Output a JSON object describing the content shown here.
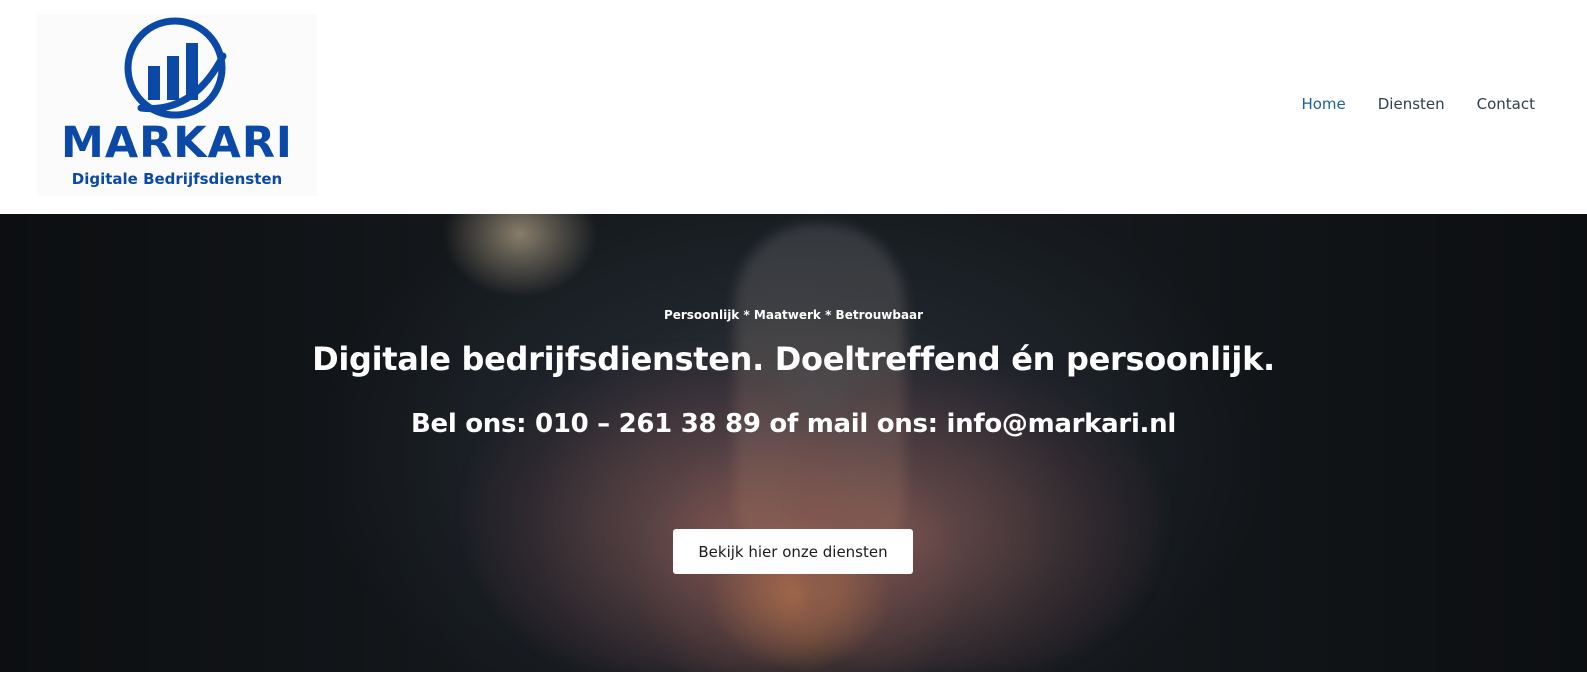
{
  "brand": {
    "name": "MARKARI",
    "tagline": "Digitale Bedrijfsdiensten",
    "color": "#0a4aa6",
    "logo_icon": "bar-chart-circle-icon"
  },
  "nav": {
    "items": [
      {
        "label": "Home",
        "active": true
      },
      {
        "label": "Diensten",
        "active": false
      },
      {
        "label": "Contact",
        "active": false
      }
    ],
    "active_color": "#1f5fa0"
  },
  "hero": {
    "kicker": "Persoonlijk * Maatwerk * Betrouwbaar",
    "title": "Digitale bedrijfsdiensten. Doeltreffend én persoonlijk.",
    "subtitle": "Bel ons: 010 – 261 38 89 of mail ons: info@markari.nl",
    "button_label": "Bekijk hier onze diensten",
    "background": "hands-holding-light-bulb-photo"
  }
}
